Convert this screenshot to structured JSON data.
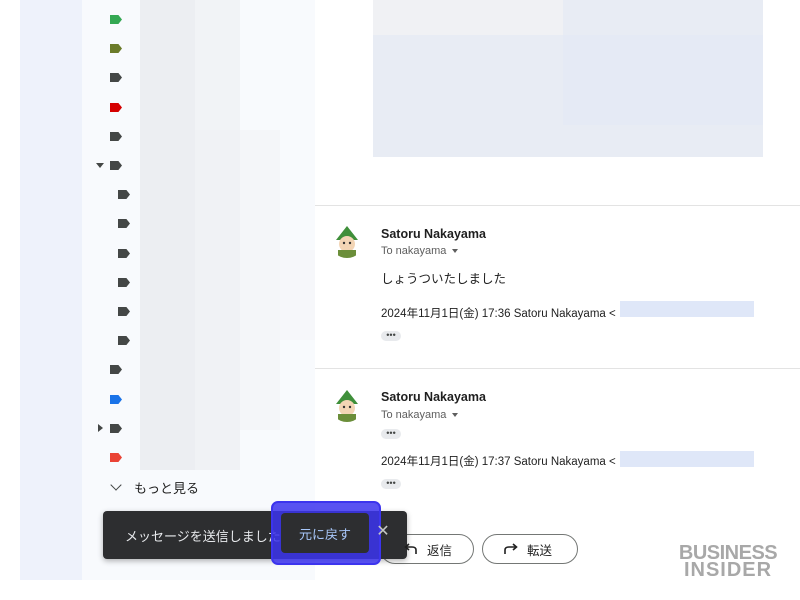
{
  "sidebar": {
    "labels": [
      {
        "color": "#34a853"
      },
      {
        "color": "#6b7b2a"
      },
      {
        "color": "#444746"
      },
      {
        "color": "#d50000"
      },
      {
        "color": "#444746"
      },
      {
        "color": "#444746",
        "expanded": true
      },
      {
        "color": "#444746",
        "nested": true
      },
      {
        "color": "#444746",
        "nested": true
      },
      {
        "color": "#444746",
        "nested": true
      },
      {
        "color": "#444746",
        "nested": true
      },
      {
        "color": "#444746",
        "nested": true
      },
      {
        "color": "#444746",
        "nested": true
      },
      {
        "color": "#444746"
      },
      {
        "color": "#1a73e8"
      },
      {
        "color": "#444746",
        "collapsed": true
      },
      {
        "color": "#ea4335"
      }
    ],
    "more_label": "もっと見る"
  },
  "messages": [
    {
      "sender": "Satoru Nakayama",
      "to": "To nakayama",
      "body": "しょうついたしました",
      "quote": "2024年11月1日(金) 17:36 Satoru Nakayama <"
    },
    {
      "sender": "Satoru Nakayama",
      "to": "To nakayama",
      "body": "",
      "quote": "2024年11月1日(金) 17:37 Satoru Nakayama <"
    }
  ],
  "actions": {
    "reply_label": "返信",
    "forward_label": "転送"
  },
  "toast": {
    "message": "メッセージを送信しました",
    "undo_label": "元に戻す",
    "close_glyph": "✕"
  },
  "logo": {
    "line1": "BUSINESS",
    "line2": "INSIDER"
  },
  "colors": {
    "undo_highlight": "#3c34ee",
    "link": "#0b57d0"
  }
}
